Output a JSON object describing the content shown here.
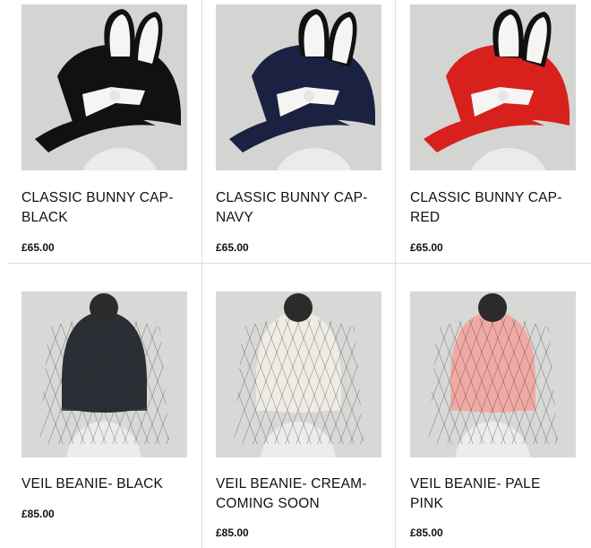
{
  "products": [
    {
      "title": "CLASSIC BUNNY CAP-\nBLACK",
      "price": "£65.00",
      "image": "bunny-cap",
      "color": "#111111",
      "image_alt": "classic-bunny-cap-black-photo"
    },
    {
      "title": "CLASSIC BUNNY CAP-\nNAVY",
      "price": "£65.00",
      "image": "bunny-cap",
      "color": "#1b2140",
      "image_alt": "classic-bunny-cap-navy-photo"
    },
    {
      "title": "CLASSIC BUNNY CAP-\nRED",
      "price": "£65.00",
      "image": "bunny-cap",
      "color": "#d8201c",
      "image_alt": "classic-bunny-cap-red-photo"
    },
    {
      "title": "VEIL BEANIE- BLACK",
      "price": "£85.00",
      "image": "veil-beanie",
      "color": "#2a2f36",
      "image_alt": "veil-beanie-black-photo"
    },
    {
      "title": "VEIL BEANIE- CREAM-\nCOMING SOON",
      "price": "£85.00",
      "image": "veil-beanie",
      "color": "#efece4",
      "image_alt": "veil-beanie-cream-photo"
    },
    {
      "title": "VEIL BEANIE- PALE\nPINK",
      "price": "£85.00",
      "image": "veil-beanie",
      "color": "#f1a9a4",
      "image_alt": "veil-beanie-pale-pink-photo"
    }
  ],
  "colors": {
    "background": "#ffffff",
    "divider": "#dcdcdc",
    "photo_backdrop": "#d9d9d9",
    "text": "#111111"
  }
}
